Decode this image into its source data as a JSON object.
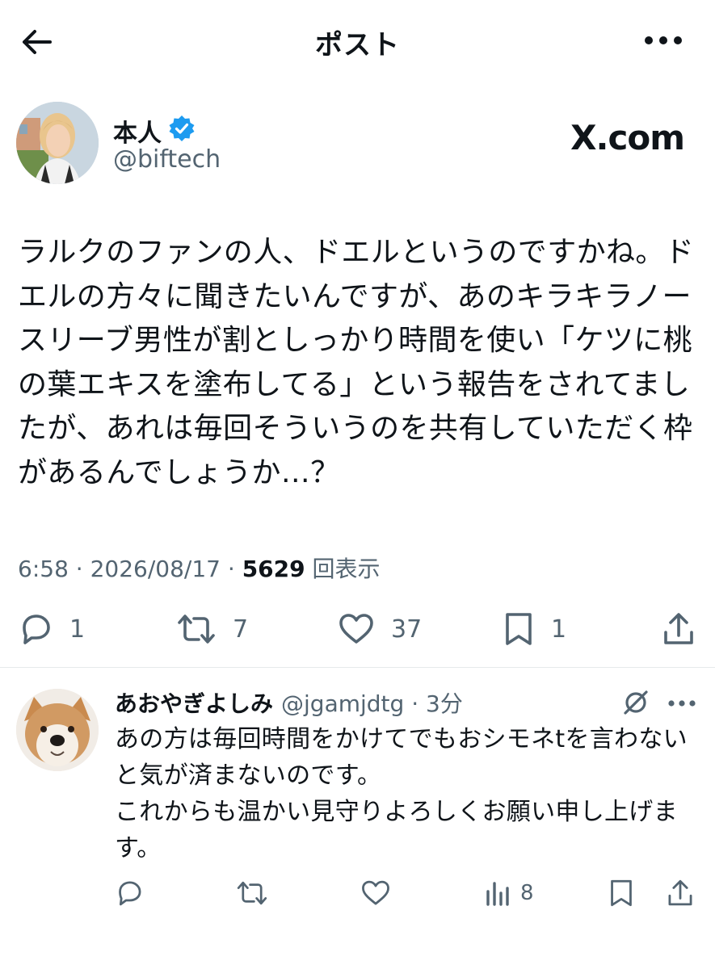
{
  "header": {
    "title": "ポスト",
    "back_icon": "arrow-left-icon",
    "more_icon": "more-horizontal-icon"
  },
  "post": {
    "author_name": "本人",
    "verified_icon": "verified-badge-icon",
    "verified_color": "#1d9bf0",
    "handle": "@biftech",
    "brand": "X.com",
    "text": "ラルクのファンの人、ドエルというのですかね。ドエルの方々に聞きたいんですが、あのキラキラノースリーブ男性が割としっかり時間を使い「ケツに桃の葉エキスを塗布してる」という報告をされてましたが、あれは毎回そういうのを共有していただく枠があるんでしょうか…？",
    "time": "6:58",
    "sep1": " · ",
    "date": "2026/08/17",
    "sep2": " · ",
    "views": "5629",
    "views_label": " 回表示",
    "actions": {
      "replies": "1",
      "reposts": "7",
      "likes": "37",
      "bookmarks": "1"
    }
  },
  "reply": {
    "name": "あおやぎよしみ",
    "handle": "@jgamjdtg",
    "dot": " · ",
    "time": "3分",
    "text": "あの方は毎回時間をかけてでもおシモネtを言わないと気が済まないのです。\nこれからも温かい見守りよろしくお願い申し上げます。",
    "views": "8"
  },
  "colors": {
    "text": "#0f1419",
    "secondary": "#536471",
    "divider": "#e6e9eb"
  }
}
